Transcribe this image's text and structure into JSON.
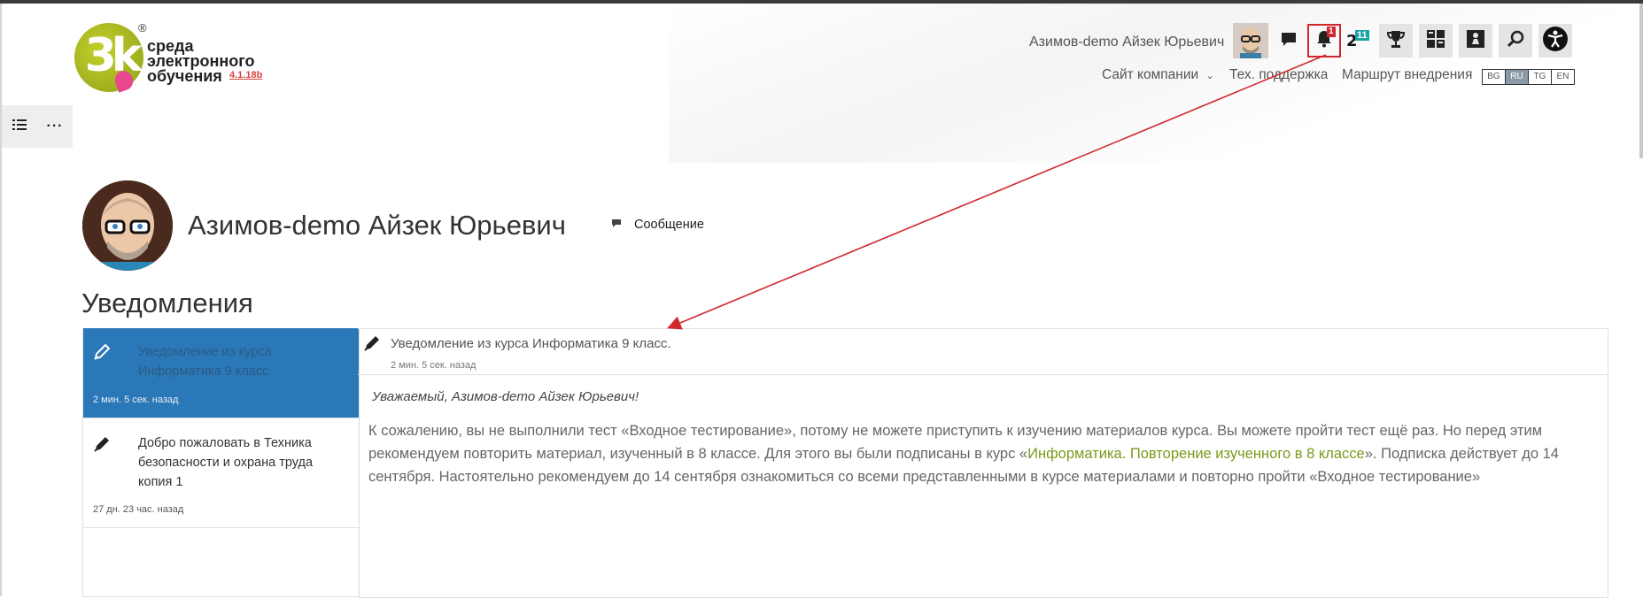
{
  "brand": {
    "logo_text_line1": "среда",
    "logo_text_line2": "электронного",
    "logo_text_line3": "обучения",
    "logo_mark": "3k",
    "registered": "®",
    "version": "4.1.18b"
  },
  "header": {
    "user_name": "Азимов-demo Айзек Юрьевич",
    "notification_count": "1",
    "level_badge_prefix": "2",
    "level_badge": "11",
    "icons": [
      "chat-icon",
      "bell-icon",
      "level-icon",
      "trophy-icon",
      "dashboard-icon",
      "chess-icon",
      "search-icon",
      "accessibility-icon"
    ],
    "nav": {
      "company_site": "Сайт компании",
      "support": "Тех. поддержка",
      "route": "Маршрут внедрения"
    },
    "languages": [
      "BG",
      "RU",
      "TG",
      "EN"
    ],
    "active_language": "RU"
  },
  "profile": {
    "name": "Азимов-demo Айзек Юрьевич",
    "message_label": "Сообщение"
  },
  "page": {
    "title": "Уведомления"
  },
  "notifications": [
    {
      "text": "Уведомление из курса Информатика 9 класс",
      "time": "2 мин. 5 сек. назад",
      "selected": true
    },
    {
      "text": "Добро пожаловать в Техника безопасности и охрана труда копия 1",
      "time": "27 дн. 23 час. назад",
      "selected": false
    }
  ],
  "detail": {
    "title": "Уведомление из курса Информатика 9 класс.",
    "time": "2 мин. 5 сек. назад",
    "greeting": "Уважаемый, Азимов-demo Айзек Юрьевич!",
    "body_part1": "К сожалению, вы не выполнили тест «Входное тестирование», потому не можете приступить к изучению материалов курса. Вы можете пройти тест ещё раз. Но перед этим рекомендуем повторить материал, изученный в 8 классе. Для этого вы были подписаны в курс «",
    "body_link": "Информатика. Повторение изученного в 8 классе",
    "body_part2": "». Подписка действует до 14 сентября. Настоятельно рекомендуем до 14 сентября ознакомиться со всеми представленными в курсе материалами и повторно пройти «Входное тестирование»"
  },
  "colors": {
    "accent_blue": "#2b78b8",
    "badge_red": "#d0282e",
    "badge_teal": "#1aa3a3",
    "link_green": "#7a9a1b",
    "annotation_red": "#d0282e"
  }
}
